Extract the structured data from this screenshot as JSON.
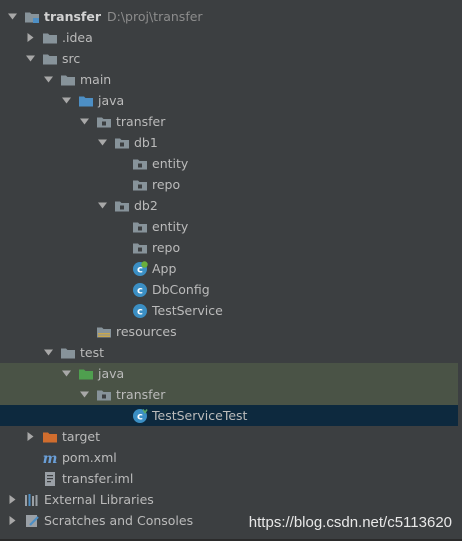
{
  "colors": {
    "folder": "#87939a",
    "source_folder": "#4d8fc5",
    "test_folder": "#4f9f4f",
    "excluded_folder": "#d06d2e",
    "class_icon": "#3b8fc4",
    "selected_row": "#0d293e",
    "test_row": "#4a5346"
  },
  "tree": [
    {
      "depth": 0,
      "arrow": "down",
      "icon": "module-folder-icon",
      "label": "transfer",
      "bold": true,
      "path": "D:\\proj\\transfer"
    },
    {
      "depth": 1,
      "arrow": "right",
      "icon": "folder-icon",
      "label": ".idea"
    },
    {
      "depth": 1,
      "arrow": "down",
      "icon": "folder-icon",
      "label": "src"
    },
    {
      "depth": 2,
      "arrow": "down",
      "icon": "folder-icon",
      "label": "main"
    },
    {
      "depth": 3,
      "arrow": "down",
      "icon": "source-folder-icon",
      "label": "java"
    },
    {
      "depth": 4,
      "arrow": "down",
      "icon": "package-icon",
      "label": "transfer"
    },
    {
      "depth": 5,
      "arrow": "down",
      "icon": "package-icon",
      "label": "db1"
    },
    {
      "depth": 6,
      "arrow": "none",
      "icon": "package-icon",
      "label": "entity"
    },
    {
      "depth": 6,
      "arrow": "none",
      "icon": "package-icon",
      "label": "repo"
    },
    {
      "depth": 5,
      "arrow": "down",
      "icon": "package-icon",
      "label": "db2"
    },
    {
      "depth": 6,
      "arrow": "none",
      "icon": "package-icon",
      "label": "entity"
    },
    {
      "depth": 6,
      "arrow": "none",
      "icon": "package-icon",
      "label": "repo"
    },
    {
      "depth": 6,
      "arrow": "none",
      "icon": "spring-class-icon",
      "label": "App"
    },
    {
      "depth": 6,
      "arrow": "none",
      "icon": "class-icon",
      "label": "DbConfig"
    },
    {
      "depth": 6,
      "arrow": "none",
      "icon": "class-icon",
      "label": "TestService"
    },
    {
      "depth": 4,
      "arrow": "none",
      "icon": "resources-folder-icon",
      "label": "resources"
    },
    {
      "depth": 2,
      "arrow": "down",
      "icon": "folder-icon",
      "label": "test"
    },
    {
      "depth": 3,
      "arrow": "down",
      "icon": "test-folder-icon",
      "label": "java",
      "row_style": "hl-green"
    },
    {
      "depth": 4,
      "arrow": "down",
      "icon": "package-icon",
      "label": "transfer",
      "row_style": "hl-green"
    },
    {
      "depth": 6,
      "arrow": "none",
      "icon": "test-class-icon",
      "label": "TestServiceTest",
      "row_style": "selected"
    },
    {
      "depth": 1,
      "arrow": "right",
      "icon": "excluded-folder-icon",
      "label": "target"
    },
    {
      "depth": 1,
      "arrow": "none",
      "icon": "maven-icon",
      "label": "pom.xml"
    },
    {
      "depth": 1,
      "arrow": "none",
      "icon": "iml-file-icon",
      "label": "transfer.iml"
    },
    {
      "depth": 0,
      "arrow": "right",
      "icon": "libraries-icon",
      "label": "External Libraries"
    },
    {
      "depth": 0,
      "arrow": "right",
      "icon": "scratches-icon",
      "label": "Scratches and Consoles"
    }
  ],
  "watermark": "https://blog.csdn.net/c5113620"
}
